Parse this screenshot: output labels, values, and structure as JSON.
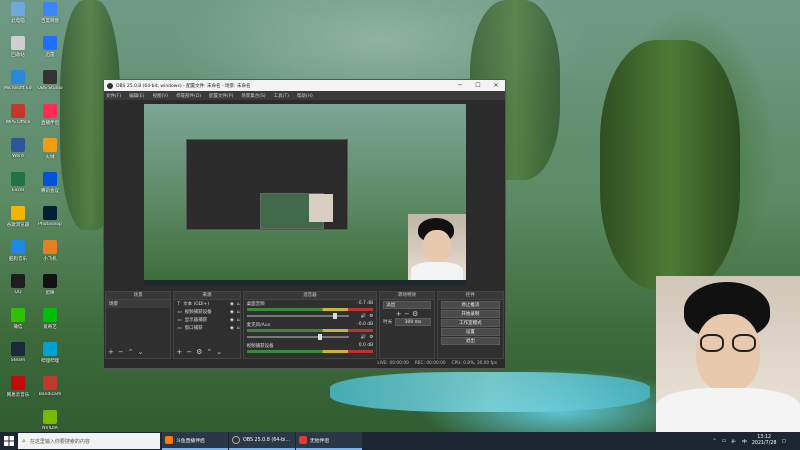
{
  "desktop": {
    "icons": [
      {
        "label": "此电脑",
        "color": "#6fa8dc"
      },
      {
        "label": "回收站",
        "color": "#cfcfcf"
      },
      {
        "label": "Microsoft Edge",
        "color": "#2b88d8"
      },
      {
        "label": "WPS Office",
        "color": "#c0392b"
      },
      {
        "label": "Word",
        "color": "#2b579a"
      },
      {
        "label": "Excel",
        "color": "#217346"
      },
      {
        "label": "谷歌浏览器",
        "color": "#f4b400"
      },
      {
        "label": "酷狗音乐",
        "color": "#1e88e5"
      },
      {
        "label": "QQ",
        "color": "#1e1e1e"
      },
      {
        "label": "微信",
        "color": "#2dc100"
      },
      {
        "label": "Steam",
        "color": "#1b2838"
      },
      {
        "label": "网易云音乐",
        "color": "#c20c0c"
      },
      {
        "label": "百度网盘",
        "color": "#3b86ff"
      },
      {
        "label": "迅雷",
        "color": "#1e6fff"
      },
      {
        "label": "OBS Studio",
        "color": "#333333"
      },
      {
        "label": "直播伴侣",
        "color": "#fe2c55"
      },
      {
        "label": "火绒",
        "color": "#f39c12"
      },
      {
        "label": "腾讯会议",
        "color": "#0052d9"
      },
      {
        "label": "Photoshop",
        "color": "#001e36"
      },
      {
        "label": "小飞机",
        "color": "#e67e22"
      },
      {
        "label": "剪映",
        "color": "#111111"
      },
      {
        "label": "爱奇艺",
        "color": "#00be06"
      },
      {
        "label": "哔哩哔哩",
        "color": "#00a1d6"
      },
      {
        "label": "Bandicam",
        "color": "#c0392b"
      },
      {
        "label": "NVIDIA",
        "color": "#76b900"
      }
    ]
  },
  "obs": {
    "title": "OBS 25.0.8 (64-bit, windows) - 配置文件: 未命名 - 场景: 未命名",
    "window_buttons": {
      "minimize": "─",
      "maximize": "☐",
      "close": "✕"
    },
    "menu": [
      "文件(F)",
      "编辑(E)",
      "视图(V)",
      "停靠部件(D)",
      "配置文件(P)",
      "场景集合(S)",
      "工具(T)",
      "帮助(H)"
    ],
    "docks": {
      "scenes": {
        "title": "场景",
        "items": [
          "场景"
        ]
      },
      "sources": {
        "title": "来源",
        "items": [
          "文本 (GDI+)",
          "视频捕获设备",
          "显示器捕获",
          "窗口捕获"
        ]
      },
      "mixer": {
        "title": "混音器",
        "channels": [
          {
            "name": "桌面音频",
            "db": "-0.7 dB",
            "level": 0.85
          },
          {
            "name": "麦克风/Aux",
            "db": "-0.0 dB",
            "level": 0.7
          },
          {
            "name": "视频捕获设备",
            "db": "0.0 dB",
            "level": 0.2
          }
        ]
      },
      "transitions": {
        "title": "转场特效",
        "type": "淡出",
        "duration_label": "时长",
        "duration": "300 ms"
      },
      "controls": {
        "title": "控件",
        "buttons": [
          "停止推流",
          "开始录制",
          "工作室模式",
          "设置",
          "退出"
        ]
      }
    },
    "status": {
      "live": "LIVE: 00:00:00",
      "rec": "REC: 00:00:00",
      "cpu": "CPU: 0.8%, 30.00 fps"
    }
  },
  "taskbar": {
    "search_placeholder": "在这里输入你要搜索的内容",
    "items": [
      {
        "label": "斗鱼直播伴侣",
        "color": "#ff7a00"
      },
      {
        "label": "OBS 25.0.8 (64-bi...",
        "color": "#333333"
      },
      {
        "label": "无他伴侣",
        "color": "#e53935"
      }
    ],
    "input_method": "中",
    "time": "13:12",
    "date": "2021/7/28"
  }
}
